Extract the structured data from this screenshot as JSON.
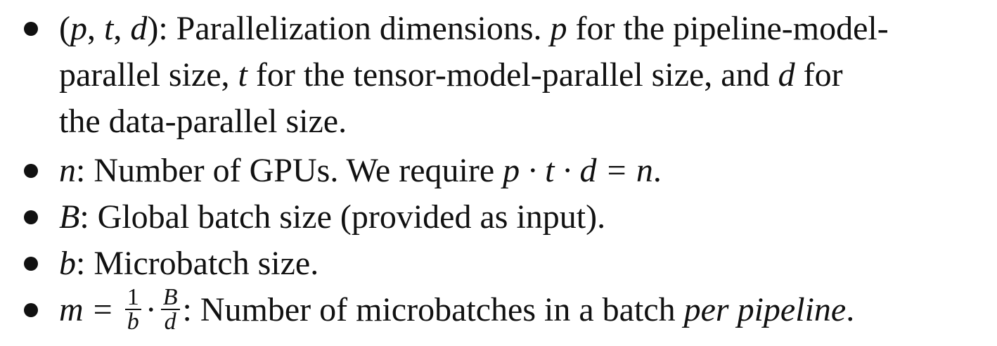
{
  "items": [
    {
      "lines": [
        "(p, t, d): Parallelization dimensions. p for the pipeline-model-",
        "parallel size, t for the tensor-model-parallel size, and d for",
        "the data-parallel size."
      ]
    },
    {
      "math": "n",
      "text": ": Number of GPUs. We require ",
      "equation": "p · t · d = n",
      "end": "."
    },
    {
      "math": "B",
      "text": ": Global batch size (provided as input)."
    },
    {
      "math": "b",
      "text": ": Microbatch size."
    },
    {
      "lhs": "m",
      "eq": "=",
      "frac1_num": "1",
      "frac1_den": "b",
      "dot": "·",
      "frac2_num": "B",
      "frac2_den": "d",
      "text": ": Number of microbatches in a batch ",
      "emph": "per pipeline",
      "end": "."
    }
  ]
}
